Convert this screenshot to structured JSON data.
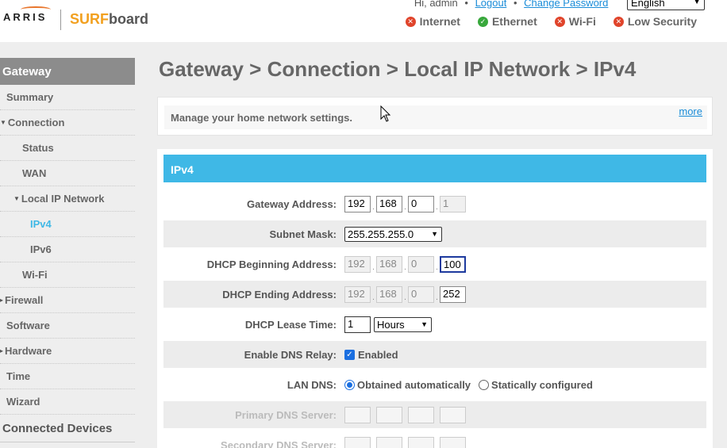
{
  "header": {
    "logo_arris": "ARRIS",
    "logo_surf": "SURF",
    "logo_board": "board",
    "greeting": "Hi, admin",
    "logout_label": "Logout",
    "change_password_label": "Change Password",
    "language": "English",
    "status": [
      {
        "label": "Internet",
        "state": "bad"
      },
      {
        "label": "Ethernet",
        "state": "good"
      },
      {
        "label": "Wi-Fi",
        "state": "bad"
      },
      {
        "label": "Low Security",
        "state": "bad"
      }
    ]
  },
  "sidebar": {
    "heading": "Gateway",
    "items": [
      {
        "label": "Summary"
      },
      {
        "label": "Connection"
      },
      {
        "label": "Status"
      },
      {
        "label": "WAN"
      },
      {
        "label": "Local IP Network"
      },
      {
        "label": "IPv4"
      },
      {
        "label": "IPv6"
      },
      {
        "label": "Wi-Fi"
      },
      {
        "label": "Firewall"
      },
      {
        "label": "Software"
      },
      {
        "label": "Hardware"
      },
      {
        "label": "Time"
      },
      {
        "label": "Wizard"
      }
    ],
    "footer": "Connected Devices"
  },
  "main": {
    "title": "Gateway > Connection > Local IP Network > IPv4",
    "description": "Manage your home network settings.",
    "more_label": "more",
    "panel_title": "IPv4",
    "fields": {
      "gateway_label": "Gateway Address:",
      "gateway": [
        "192",
        "168",
        "0",
        "1"
      ],
      "subnet_label": "Subnet Mask:",
      "subnet": "255.255.255.0",
      "dhcp_begin_label": "DHCP Beginning Address:",
      "dhcp_begin": [
        "192",
        "168",
        "0",
        "100"
      ],
      "dhcp_end_label": "DHCP Ending Address:",
      "dhcp_end": [
        "192",
        "168",
        "0",
        "252"
      ],
      "lease_label": "DHCP Lease Time:",
      "lease_value": "1",
      "lease_unit": "Hours",
      "dns_relay_label": "Enable DNS Relay:",
      "dns_relay_text": "Enabled",
      "lan_dns_label": "LAN DNS:",
      "lan_dns_auto": "Obtained automatically",
      "lan_dns_static": "Statically configured",
      "primary_dns_label": "Primary DNS Server:",
      "secondary_dns_label": "Secondary DNS Server:"
    }
  }
}
